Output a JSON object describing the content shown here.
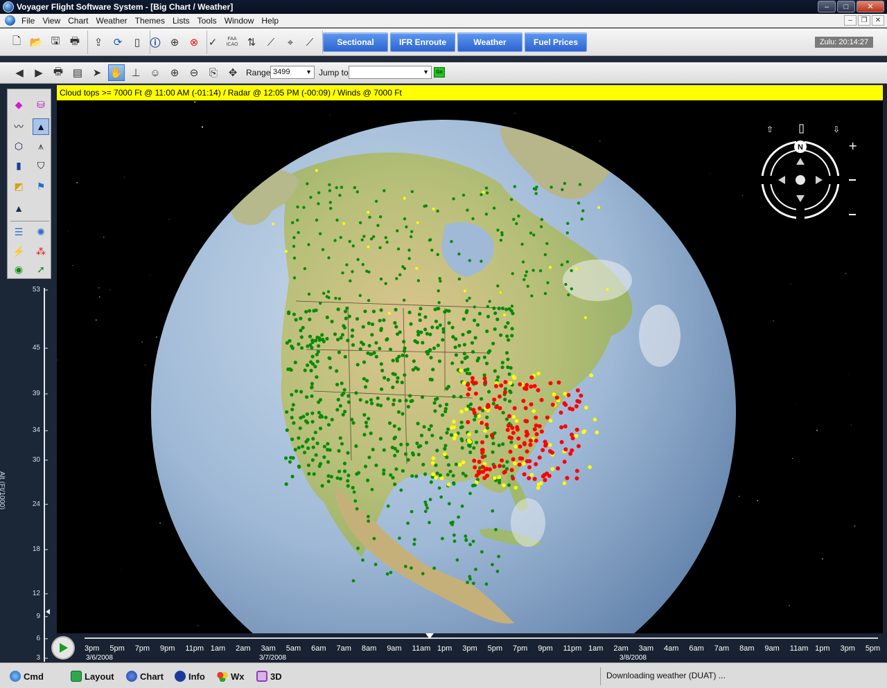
{
  "window": {
    "title": "Voyager Flight Software System - [Big Chart / Weather]"
  },
  "menu": [
    "File",
    "View",
    "Chart",
    "Weather",
    "Themes",
    "Lists",
    "Tools",
    "Window",
    "Help"
  ],
  "toolbar": {
    "faa_label": "FAA ICAO",
    "chart_buttons": [
      "Sectional",
      "IFR Enroute",
      "Weather",
      "Fuel Prices"
    ],
    "zulu": "Zulu: 20:14:27"
  },
  "nav": {
    "range_label": "Range",
    "range_value": "3499",
    "jump_label": "Jump to",
    "jump_value": "",
    "go_label": "Go"
  },
  "banner": "Cloud tops >= 7000 Ft @ 11:00 AM (-01:14) / Radar @ 12:05 PM (-00:09) / Winds @ 7000 Ft",
  "altitude": {
    "label": "Alt (Ft/1000)",
    "ticks": [
      "53",
      "45",
      "39",
      "34",
      "30",
      "24",
      "18",
      "12",
      "9",
      "6",
      "3"
    ],
    "current_fraction": 0.07
  },
  "compass": {
    "north_label": "N"
  },
  "timeline": {
    "labels": [
      "3pm",
      "5pm",
      "7pm",
      "9pm",
      "11pm",
      "1am",
      "2am",
      "3am",
      "5am",
      "6am",
      "7am",
      "8am",
      "9am",
      "11am",
      "1pm",
      "3pm",
      "5pm",
      "7pm",
      "9pm",
      "11pm",
      "1am",
      "2am",
      "3am",
      "4am",
      "6am",
      "7am",
      "8am",
      "9am",
      "11am",
      "1pm",
      "3pm",
      "5pm"
    ],
    "dates": [
      "3/6/2008",
      "3/7/2008",
      "3/8/2008"
    ],
    "current_fraction": 0.43
  },
  "tabs": [
    "Cmd",
    "Layout",
    "Chart",
    "Info",
    "Wx",
    "3D"
  ],
  "status": "Downloading weather (DUAT) ...",
  "colors": {
    "banner": "#ffff00",
    "vfr": "#0a8a0a",
    "mvfr": "#ffff00",
    "ifr": "#ff0000",
    "chart_button": "#3a73d8"
  }
}
